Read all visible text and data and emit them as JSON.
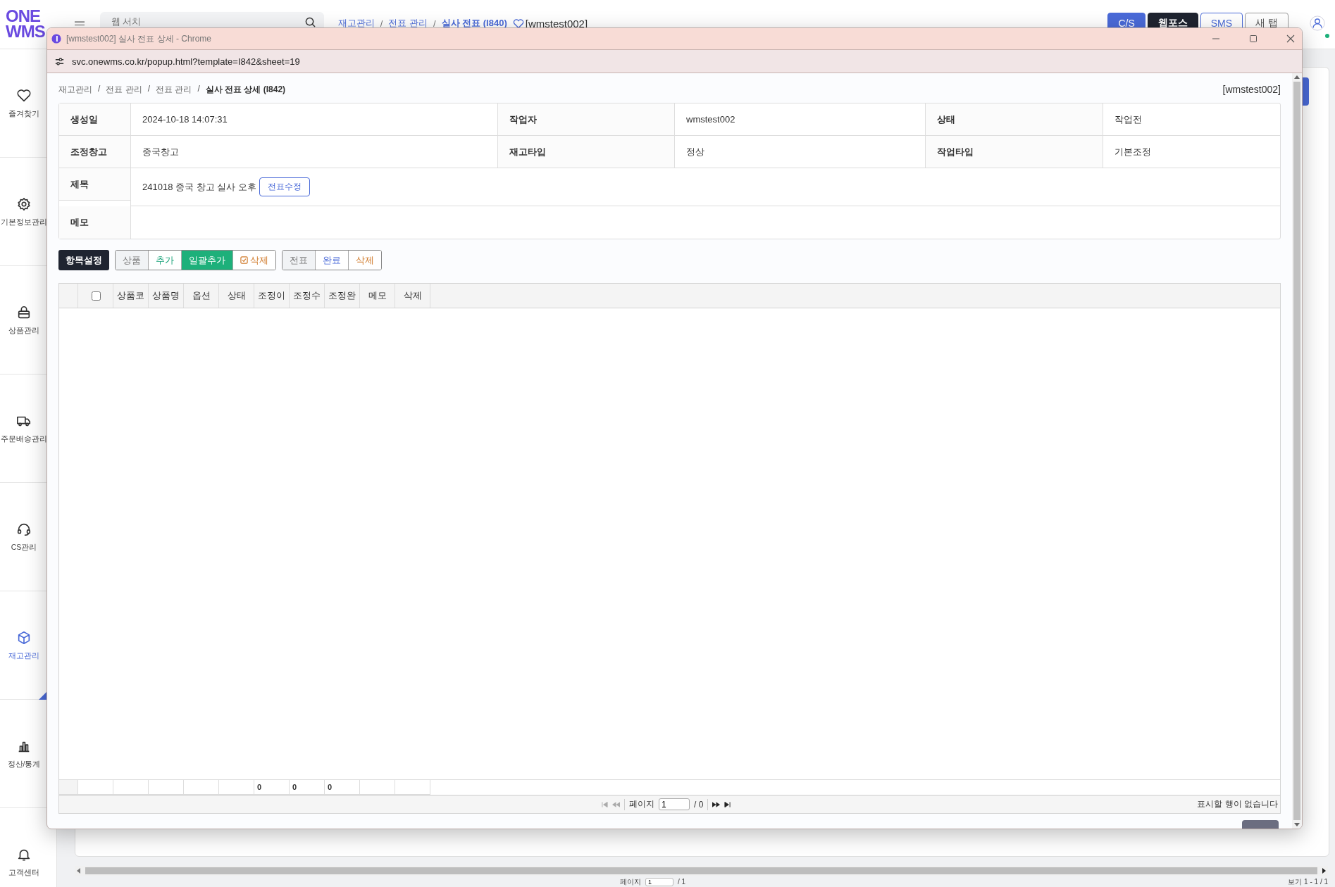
{
  "app": {
    "logo_top": "ONE",
    "logo_bottom": "WMS",
    "search": {
      "placeholder": "웹 서치"
    },
    "breadcrumb": [
      {
        "label": "재고관리",
        "current": false
      },
      {
        "separator": "/",
        "label": "전표 관리",
        "current": false
      },
      {
        "separator": "/",
        "label": "실사 전표 (I840)",
        "current": true
      }
    ],
    "user_tag": "[wmstest002]",
    "header_buttons": [
      {
        "label": "C/S",
        "kind": "primary"
      },
      {
        "label": "웹포스",
        "kind": "dark"
      },
      {
        "label": "SMS",
        "kind": "outline"
      },
      {
        "label": "새 탭",
        "kind": "plain"
      }
    ],
    "user_online": true,
    "sidebar": [
      {
        "label": "즐겨찾기",
        "selected": false
      },
      {
        "label": "기본정보관리",
        "selected": false
      },
      {
        "label": "상품관리",
        "selected": false
      },
      {
        "label": "주문배송관리",
        "selected": false
      },
      {
        "label": "CS관리",
        "selected": false
      },
      {
        "label": "재고관리",
        "selected": true
      },
      {
        "label": "정산/통계",
        "selected": false
      },
      {
        "label": "고객센터",
        "selected": false
      }
    ],
    "pager": {
      "label": "페이지",
      "page": "1",
      "total": "/ 1",
      "summary": "보기 1 - 1 / 1"
    }
  },
  "popup": {
    "window": {
      "title": "[wmstest002] 실사 전표 상세 - Chrome",
      "url": "svc.onewms.co.kr/popup.html?template=I842&sheet=19"
    },
    "breadcrumb": [
      {
        "label": "재고관리",
        "current": false
      },
      {
        "separator": "/",
        "label": "전표 관리",
        "current": false
      },
      {
        "separator": "/",
        "label": "전표 관리",
        "current": false
      },
      {
        "separator": "/",
        "label": "실사 전표 상세 (I842)",
        "current": true
      }
    ],
    "user_tag": "[wmstest002]",
    "info_rows": [
      [
        {
          "label": "생성일",
          "value": "2024-10-18 14:07:31"
        },
        {
          "label": "작업자",
          "value": "wmstest002"
        },
        {
          "label": "상태",
          "value": "작업전"
        }
      ],
      [
        {
          "label": "조정창고",
          "value": "중국창고"
        },
        {
          "label": "재고타입",
          "value": "정상"
        },
        {
          "label": "작업타입",
          "value": "기본조정"
        }
      ],
      [
        {
          "label": "제목",
          "value": "241018 중국 창고 실사 오후",
          "button": "전표수정"
        }
      ],
      [
        {
          "label": "메모"
        }
      ]
    ],
    "settings_button": "항목설정",
    "button_groups": [
      [
        {
          "label": "상품",
          "kind": "label"
        },
        {
          "label": "추가",
          "kind": "add"
        },
        {
          "label": "일괄추가",
          "kind": "bulk"
        },
        {
          "label": "삭제",
          "kind": "check-delete"
        }
      ],
      [
        {
          "label": "전표",
          "kind": "label"
        },
        {
          "label": "완료",
          "kind": "complete"
        },
        {
          "label": "삭제",
          "kind": "delete"
        }
      ]
    ],
    "grid": {
      "select_all": {
        "checked": false
      },
      "columns": [
        {
          "label": "상품코"
        },
        {
          "label": "상품명"
        },
        {
          "label": "옵션"
        },
        {
          "label": "상태"
        },
        {
          "label": "조정이",
          "total": "0"
        },
        {
          "label": "조정수",
          "total": "0"
        },
        {
          "label": "조정완",
          "total": "0"
        },
        {
          "label": "메모"
        },
        {
          "label": "삭제"
        }
      ],
      "pager": {
        "label": "페이지",
        "page": "1",
        "total": "/ 0",
        "back_disabled": true,
        "forward_disabled": false,
        "message": "표시할 행이 없습니다"
      }
    }
  }
}
